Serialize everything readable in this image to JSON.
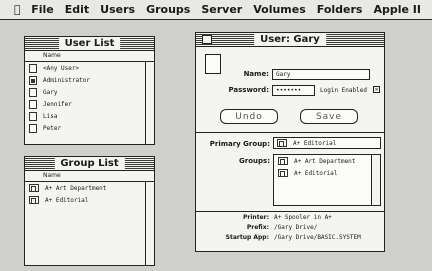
{
  "menubar": {
    "apple_icon": "apple-icon",
    "items": [
      "File",
      "Edit",
      "Users",
      "Groups",
      "Server",
      "Volumes",
      "Folders",
      "Apple II"
    ]
  },
  "user_list": {
    "title": "User List",
    "column": "Name",
    "items": [
      "<Any User>",
      "Administrator",
      "Gary",
      "Jennifer",
      "Lisa",
      "Peter"
    ]
  },
  "group_list": {
    "title": "Group List",
    "column": "Name",
    "items": [
      "A+ Art Department",
      "A+ Editorial"
    ]
  },
  "user_window": {
    "title": "User: Gary",
    "name_label": "Name:",
    "name_value": "Gary",
    "password_label": "Password:",
    "password_value": "•••••••",
    "login_enabled_label": "Login Enabled",
    "login_enabled_checked": true,
    "undo_label": "Undo",
    "save_label": "Save",
    "primary_group_label": "Primary Group:",
    "primary_group_value": "A+ Editorial",
    "groups_label": "Groups:",
    "groups": [
      "A+ Art Department",
      "A+ Editorial"
    ],
    "printer_label": "Printer:",
    "printer_value": "A+ Spooler in A+",
    "prefix_label": "Prefix:",
    "prefix_value": "/Gary Drive/",
    "startup_label": "Startup App:",
    "startup_value": "/Gary Drive/BASIC.SYSTEM"
  }
}
